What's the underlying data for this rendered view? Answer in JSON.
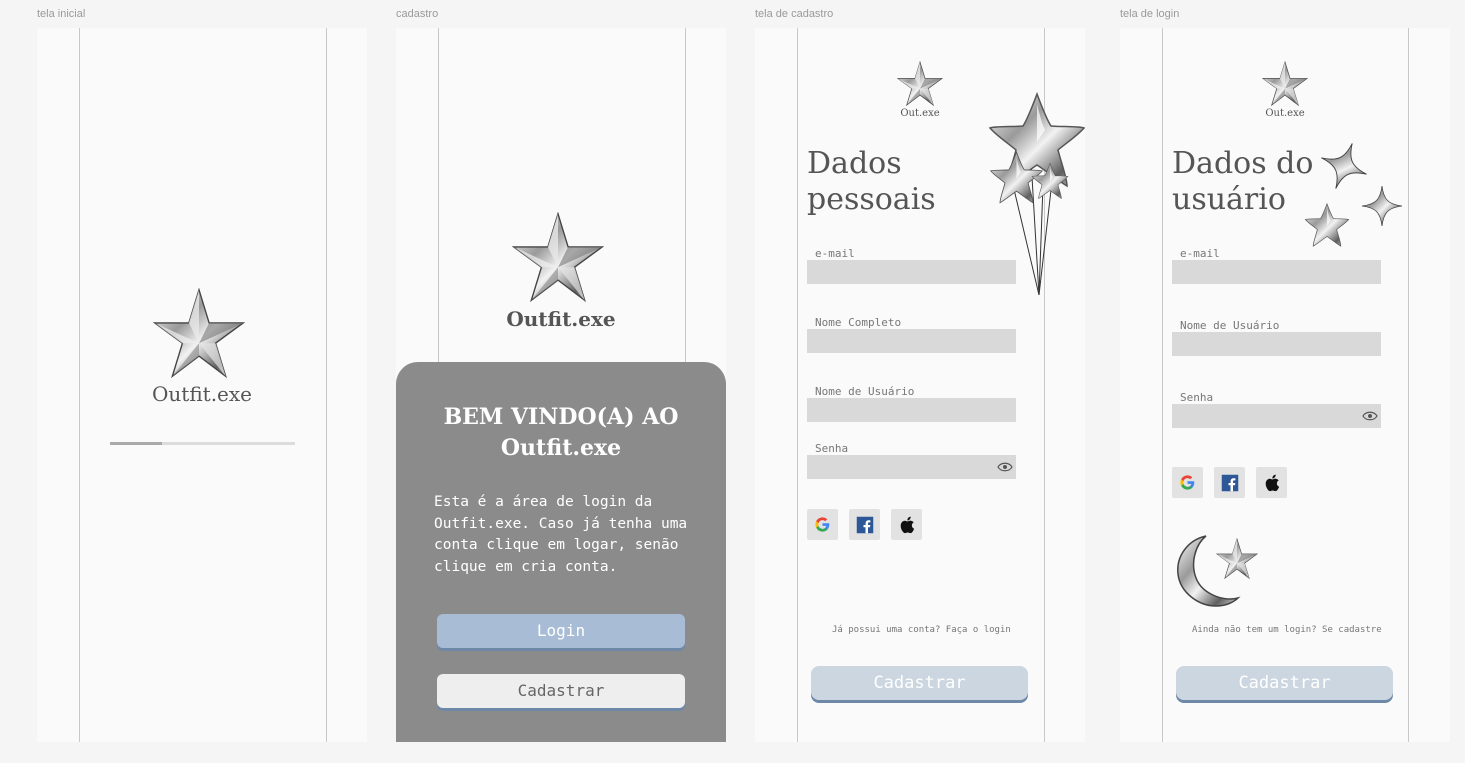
{
  "frames": {
    "initial": {
      "label": "tela inicial",
      "logo": "Outfit.exe",
      "progress": 0.28
    },
    "signup_intro": {
      "label": "cadastro",
      "logo": "Outfit.exe",
      "welcome_title_line1": "BEM VINDO(A) AO",
      "welcome_title_line2": "Outfit.exe",
      "welcome_body": "Esta é a área de login da Outfit.exe. Caso já tenha uma conta clique em logar, senão clique em cria conta.",
      "login_button": "Login",
      "register_button": "Cadastrar"
    },
    "signup_form": {
      "label": "tela de cadastro",
      "logo": "Out.exe",
      "heading_line1": "Dados",
      "heading_line2": "pessoais",
      "fields": {
        "email": "e-mail",
        "full_name": "Nome Completo",
        "username": "Nome de Usuário",
        "password": "Senha"
      },
      "footnote": "Já possui uma conta? Faça o login",
      "submit": "Cadastrar"
    },
    "login_form": {
      "label": "tela de login",
      "logo": "Out.exe",
      "heading_line1": "Dados do",
      "heading_line2": "usuário",
      "fields": {
        "email": "e-mail",
        "username": "Nome de Usuário",
        "password": "Senha"
      },
      "footnote": "Ainda não tem um login? Se cadastre",
      "submit": "Cadastrar"
    }
  },
  "icons": [
    "star-logo-icon",
    "eye-icon",
    "google-icon",
    "facebook-icon",
    "apple-icon",
    "star-balloons-icon",
    "sparkle-stars-icon",
    "moon-star-icon"
  ],
  "colors": {
    "card": "#8c8b8b",
    "login_button": "#a8bdd5",
    "submit_button": "#ccd6e0",
    "button_shadow": "#6e88a8",
    "input": "#d9d9d9"
  }
}
